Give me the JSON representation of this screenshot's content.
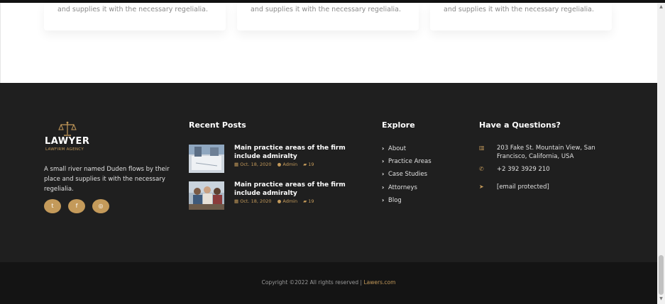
{
  "services": {
    "cards": [
      {
        "text": "and supplies it with the necessary regelialia."
      },
      {
        "text": "and supplies it with the necessary regelialia."
      },
      {
        "text": "and supplies it with the necessary regelialia."
      }
    ]
  },
  "brand": {
    "name": "LAWYER",
    "tagline": "LAWFIRM AGENCY",
    "about": "A small river named Duden flows by their place and supplies it with the necessary regelialia.",
    "accent": "#c49a5a"
  },
  "social": [
    {
      "icon": "twitter-icon",
      "glyph": "t"
    },
    {
      "icon": "facebook-icon",
      "glyph": "f"
    },
    {
      "icon": "instagram-icon",
      "glyph": "◎"
    }
  ],
  "recent_posts": {
    "title": "Recent Posts",
    "items": [
      {
        "title": "Main practice areas of the firm include admiralty",
        "date": "Oct. 18, 2020",
        "author": "Admin",
        "comments": "19"
      },
      {
        "title": "Main practice areas of the firm include admiralty",
        "date": "Oct. 18, 2020",
        "author": "Admin",
        "comments": "19"
      }
    ]
  },
  "explore": {
    "title": "Explore",
    "items": [
      "About",
      "Practice Areas",
      "Case Studies",
      "Attorneys",
      "Blog"
    ]
  },
  "contact": {
    "title": "Have a Questions?",
    "address": "203 Fake St. Mountain View, San Francisco, California, USA",
    "phone": "+2 392 3929 210",
    "email": "[email protected]"
  },
  "footer": {
    "copyright": "Copyright ©2022 All rights reserved | ",
    "site": "Lawers.com"
  }
}
